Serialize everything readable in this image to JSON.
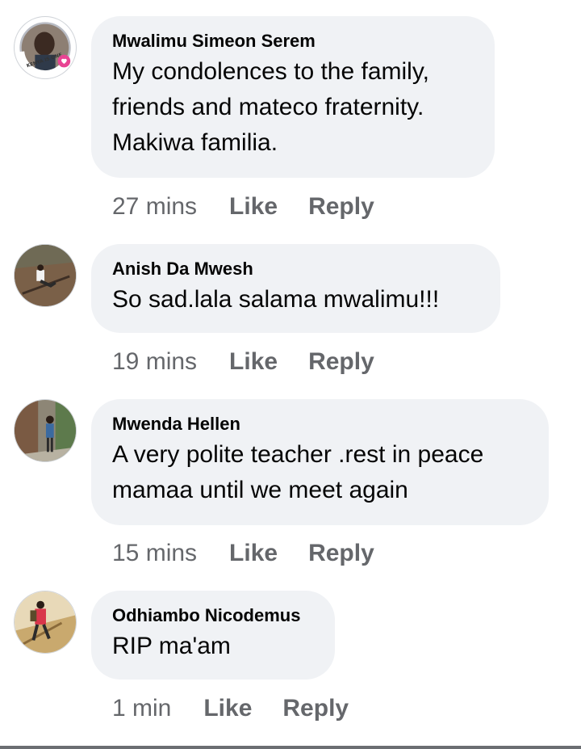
{
  "comments": [
    {
      "author": "Mwalimu Simeon Serem",
      "text": "My condolences to the family, friends and mateco fraternity. Makiwa familia.",
      "time": "27 mins",
      "like_label": "Like",
      "reply_label": "Reply",
      "avatar_icon": "profile-photo-man-with-frame-icon",
      "avatar_frame_text": "KENYA IS ONE CHANGE"
    },
    {
      "author": "Anish Da Mwesh",
      "text": "So sad.lala salama mwalimu!!!",
      "time": "19 mins",
      "like_label": "Like",
      "reply_label": "Reply",
      "avatar_icon": "profile-photo-person-sitting-icon"
    },
    {
      "author": "Mwenda Hellen",
      "text": "A very polite teacher .rest in peace mamaa until we meet again",
      "time": "15 mins",
      "like_label": "Like",
      "reply_label": "Reply",
      "avatar_icon": "profile-photo-person-standing-icon"
    },
    {
      "author": "Odhiambo Nicodemus",
      "text": "RIP ma'am",
      "time": "1 min",
      "like_label": "Like",
      "reply_label": "Reply",
      "avatar_icon": "profile-photo-person-with-backpack-icon"
    }
  ],
  "colors": {
    "bubble_background": "#f0f2f5",
    "text_primary": "#050505",
    "text_secondary": "#65676b",
    "avatar_badge": "#e84393"
  }
}
